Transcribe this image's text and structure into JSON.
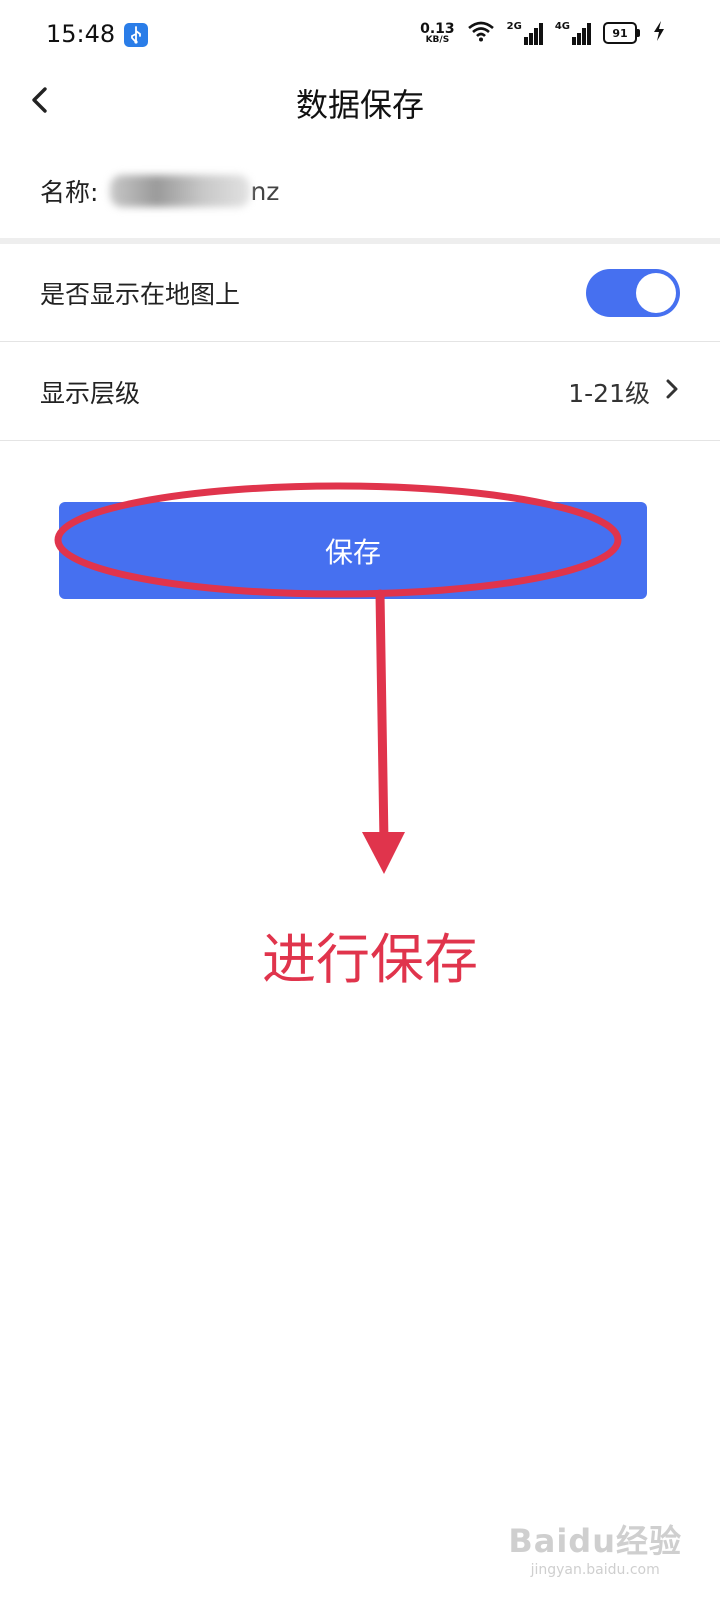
{
  "status_bar": {
    "time": "15:48",
    "net_speed_value": "0.13",
    "net_speed_unit": "KB/S",
    "sim1_tag": "2G",
    "sim2_tag": "4G",
    "battery_level": "91",
    "icons": [
      "usb-icon",
      "wifi-icon",
      "signal-icon",
      "battery-icon",
      "charging-icon"
    ]
  },
  "header": {
    "title": "数据保存",
    "back_icon": "chevron-left-icon"
  },
  "form": {
    "name_label": "名称:",
    "name_visible_suffix": "nz",
    "show_on_map_label": "是否显示在地图上",
    "show_on_map_enabled": true,
    "display_level_label": "显示层级",
    "display_level_value": "1-21级"
  },
  "actions": {
    "save_label": "保存"
  },
  "annotation": {
    "text": "进行保存",
    "color": "#e0344c"
  },
  "watermark": {
    "logo": "Baidu经验",
    "sub": "jingyan.baidu.com"
  },
  "colors": {
    "accent": "#4670f0",
    "annotation": "#e0344c"
  }
}
